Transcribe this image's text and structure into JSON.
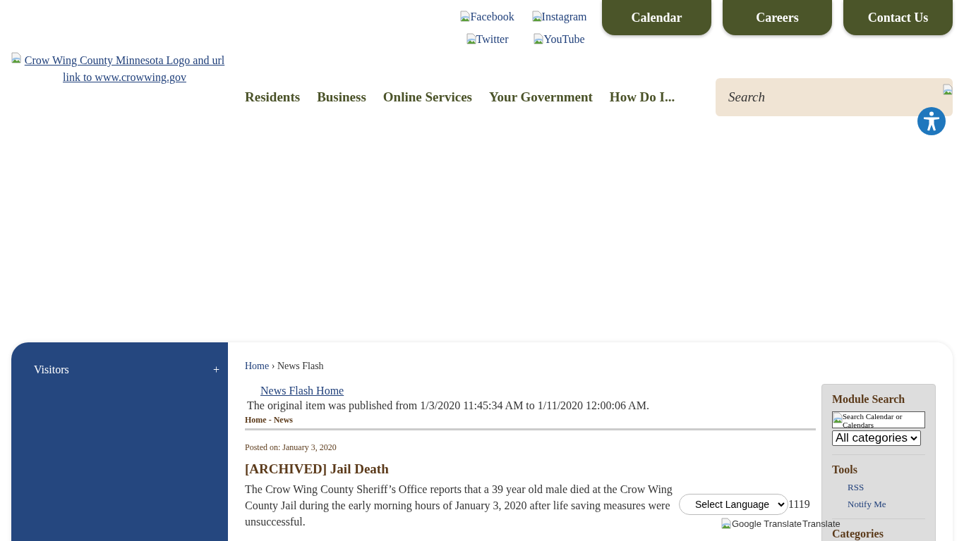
{
  "logo": {
    "alt": "Crow Wing County Minnesota Logo and url link to www.crowwing.gov"
  },
  "social_links": [
    {
      "label": "Facebook"
    },
    {
      "label": "Instagram"
    },
    {
      "label": "Twitter"
    },
    {
      "label": "YouTube"
    }
  ],
  "top_buttons": [
    "Calendar",
    "Careers",
    "Contact Us"
  ],
  "nav": [
    "Residents",
    "Business",
    "Online Services",
    "Your Government",
    "How Do I..."
  ],
  "search": {
    "placeholder": "Search"
  },
  "side_menu": [
    {
      "label": "Visitors",
      "toggle": "+"
    }
  ],
  "breadcrumb": {
    "items": [
      "Home",
      "News Flash"
    ],
    "separator": "›"
  },
  "news_flash_home": "News Flash Home",
  "archive_note": "The original item was published from 1/3/2020 11:45:34 AM to 1/11/2020 12:00:06 AM.",
  "section_title": "Home - News",
  "posted_on": "Posted on: January 3, 2020",
  "article_title": "[ARCHIVED] Jail Death",
  "article_body": "The Crow Wing County Sheriff’s Office reports that a 39 year old male died at the Crow Wing County Jail during the early morning hours of January 3, 2020 after life saving measures were unsuccessful.",
  "module_sidebar": {
    "heading": "Module Search",
    "search_image_alt": "Search Calendar or Calendars",
    "category_select": "All categories",
    "tools_heading": "Tools",
    "tools": [
      "RSS",
      "Notify Me"
    ],
    "categories_heading": "Categories"
  },
  "translate": {
    "select": "Select Language",
    "count": "1119",
    "image_alt": "Google Translate",
    "label": "Translate"
  }
}
